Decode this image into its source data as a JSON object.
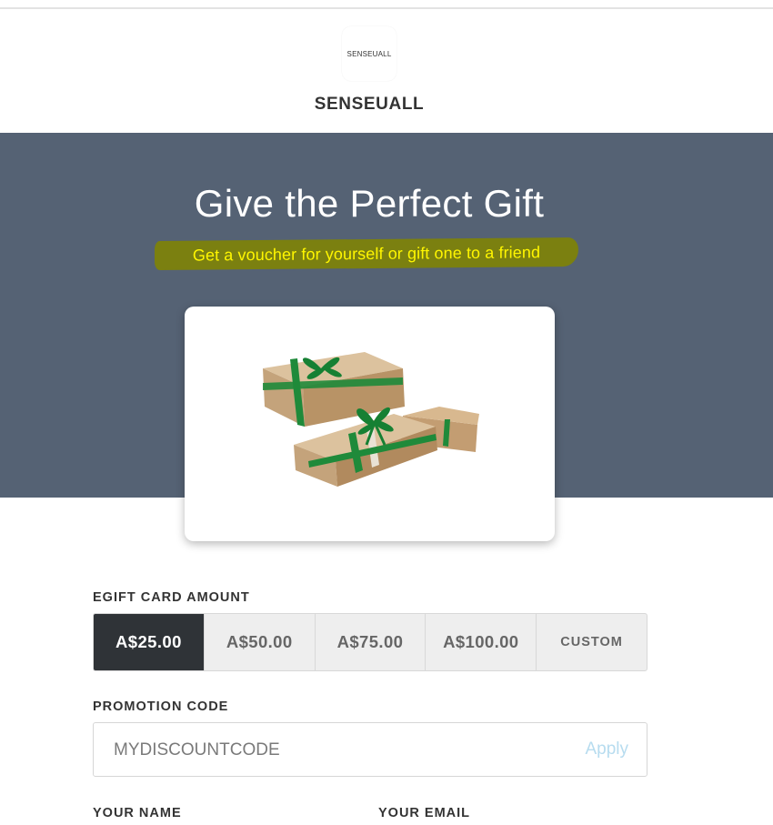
{
  "brand": {
    "logo_text": "SENSEUALL",
    "name": "SENSEUALL"
  },
  "hero": {
    "title": "Give the Perfect Gift",
    "subtitle": "Get a voucher for yourself or gift one to a friend",
    "background_color": "#556274",
    "highlight_color": "#7b8010",
    "highlight_text_color": "#fff600"
  },
  "gift_image": {
    "icon": "gift-boxes-image"
  },
  "form": {
    "amount_label": "EGIFT CARD AMOUNT",
    "amounts": [
      {
        "label": "A$25.00",
        "selected": true
      },
      {
        "label": "A$50.00",
        "selected": false
      },
      {
        "label": "A$75.00",
        "selected": false
      },
      {
        "label": "A$100.00",
        "selected": false
      },
      {
        "label": "CUSTOM",
        "selected": false
      }
    ],
    "promo_label": "PROMOTION CODE",
    "promo_placeholder": "MYDISCOUNTCODE",
    "promo_apply": "Apply",
    "name_label": "YOUR NAME",
    "email_label": "YOUR EMAIL"
  },
  "colors": {
    "selected_amount_bg": "#2f3337",
    "apply_link": "#b7dcef"
  }
}
